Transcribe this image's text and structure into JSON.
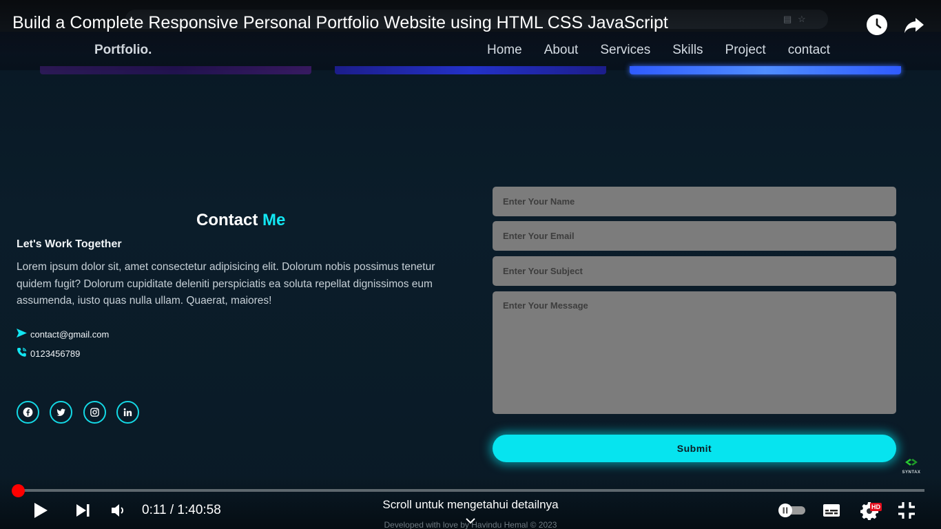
{
  "video": {
    "title": "Build a Complete Responsive Personal Portfolio Website using HTML CSS JavaScript",
    "time_current": "0:11",
    "time_separator": " / ",
    "time_total": "1:40:58",
    "progress_fraction": 0.0018,
    "scroll_hint": "Scroll untuk mengetahui detailnya",
    "hd_label": "HD"
  },
  "site": {
    "logo": "Portfolio.",
    "nav": [
      "Home",
      "About",
      "Services",
      "Skills",
      "Project",
      "contact"
    ]
  },
  "contact": {
    "title_main": "Contact ",
    "title_accent": "Me",
    "subheading": "Let's Work Together",
    "paragraph": "Lorem ipsum dolor sit, amet consectetur adipisicing elit. Dolorum nobis possimus tenetur quidem fugit? Dolorum cupiditate deleniti perspiciatis ea soluta repellat dignissimos eum assumenda, iusto quas nulla ullam. Quaerat, maiores!",
    "email": "contact@gmail.com",
    "phone": "0123456789",
    "socials": [
      "facebook-icon",
      "twitter-icon",
      "instagram-icon",
      "linkedin-icon"
    ]
  },
  "form": {
    "name_placeholder": "Enter Your Name",
    "email_placeholder": "Enter Your Email",
    "subject_placeholder": "Enter Your Subject",
    "message_placeholder": "Enter Your Message",
    "submit_label": "Submit"
  },
  "footer": {
    "credit": "Developed with love by Havindu Hemal © 2023"
  },
  "watermark": {
    "text": "SYNTAX"
  },
  "colors": {
    "accent": "#12e6f2",
    "background": "#0a1a26",
    "progress": "#ff0000"
  }
}
